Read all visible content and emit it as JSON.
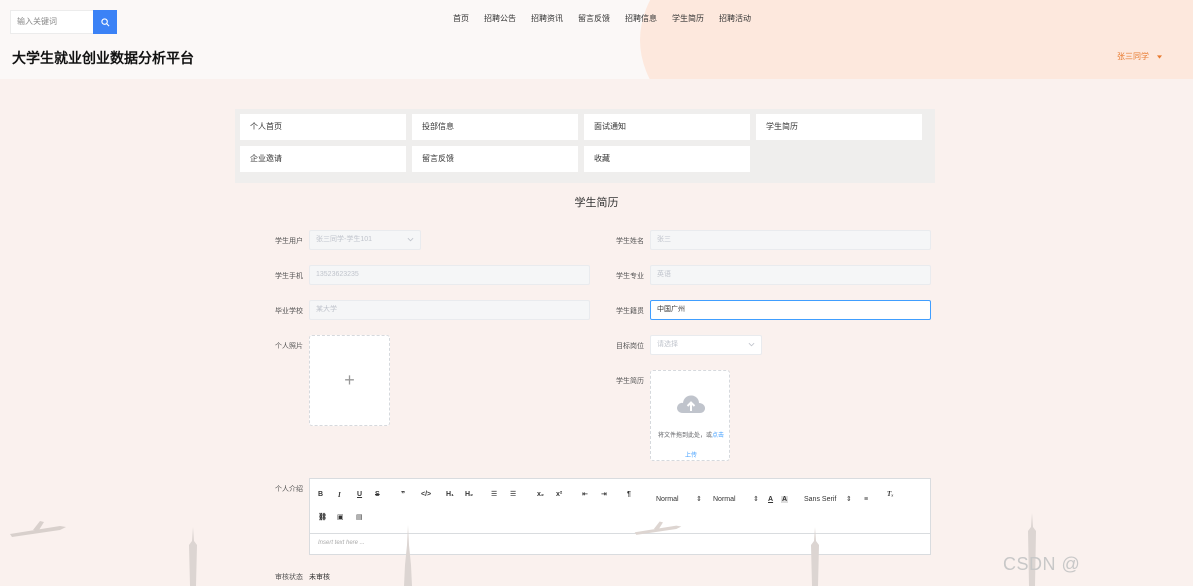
{
  "header": {
    "search_placeholder": "输入关键词",
    "site_title": "大学生就业创业数据分析平台",
    "user_name": "张三同学",
    "nav": [
      "首页",
      "招聘公告",
      "招聘资讯",
      "留言反馈",
      "招聘信息",
      "学生简历",
      "招聘活动"
    ]
  },
  "menu": {
    "items": [
      "个人首页",
      "投部信息",
      "面试通知",
      "学生简历",
      "企业邀请",
      "留言反馈",
      "收藏"
    ]
  },
  "form": {
    "title": "学生简历",
    "student_user_label": "学生用户",
    "student_user_value": "张三同学-学生101",
    "student_name_label": "学生姓名",
    "student_name_value": "张三",
    "phone_label": "学生手机",
    "phone_value": "13523623235",
    "major_label": "学生专业",
    "major_value": "英语",
    "school_label": "毕业学校",
    "school_value": "某大学",
    "origin_label": "学生籍贯",
    "origin_value": "中国广州",
    "photo_label": "个人照片",
    "position_label": "目标岗位",
    "position_placeholder": "请选择",
    "resume_label": "学生简历",
    "upload_hint_prefix": "将文件拖到此处，或",
    "upload_hint_link": "点击",
    "upload_hint_link2": "上传",
    "intro_label": "个人介绍",
    "editor_placeholder": "Insert text here ...",
    "status_label": "审核状态",
    "status_value": "未审核"
  },
  "toolbar": {
    "header_select": "Normal",
    "size_select": "Normal",
    "font_select": "Sans Serif"
  },
  "watermark": "CSDN @"
}
